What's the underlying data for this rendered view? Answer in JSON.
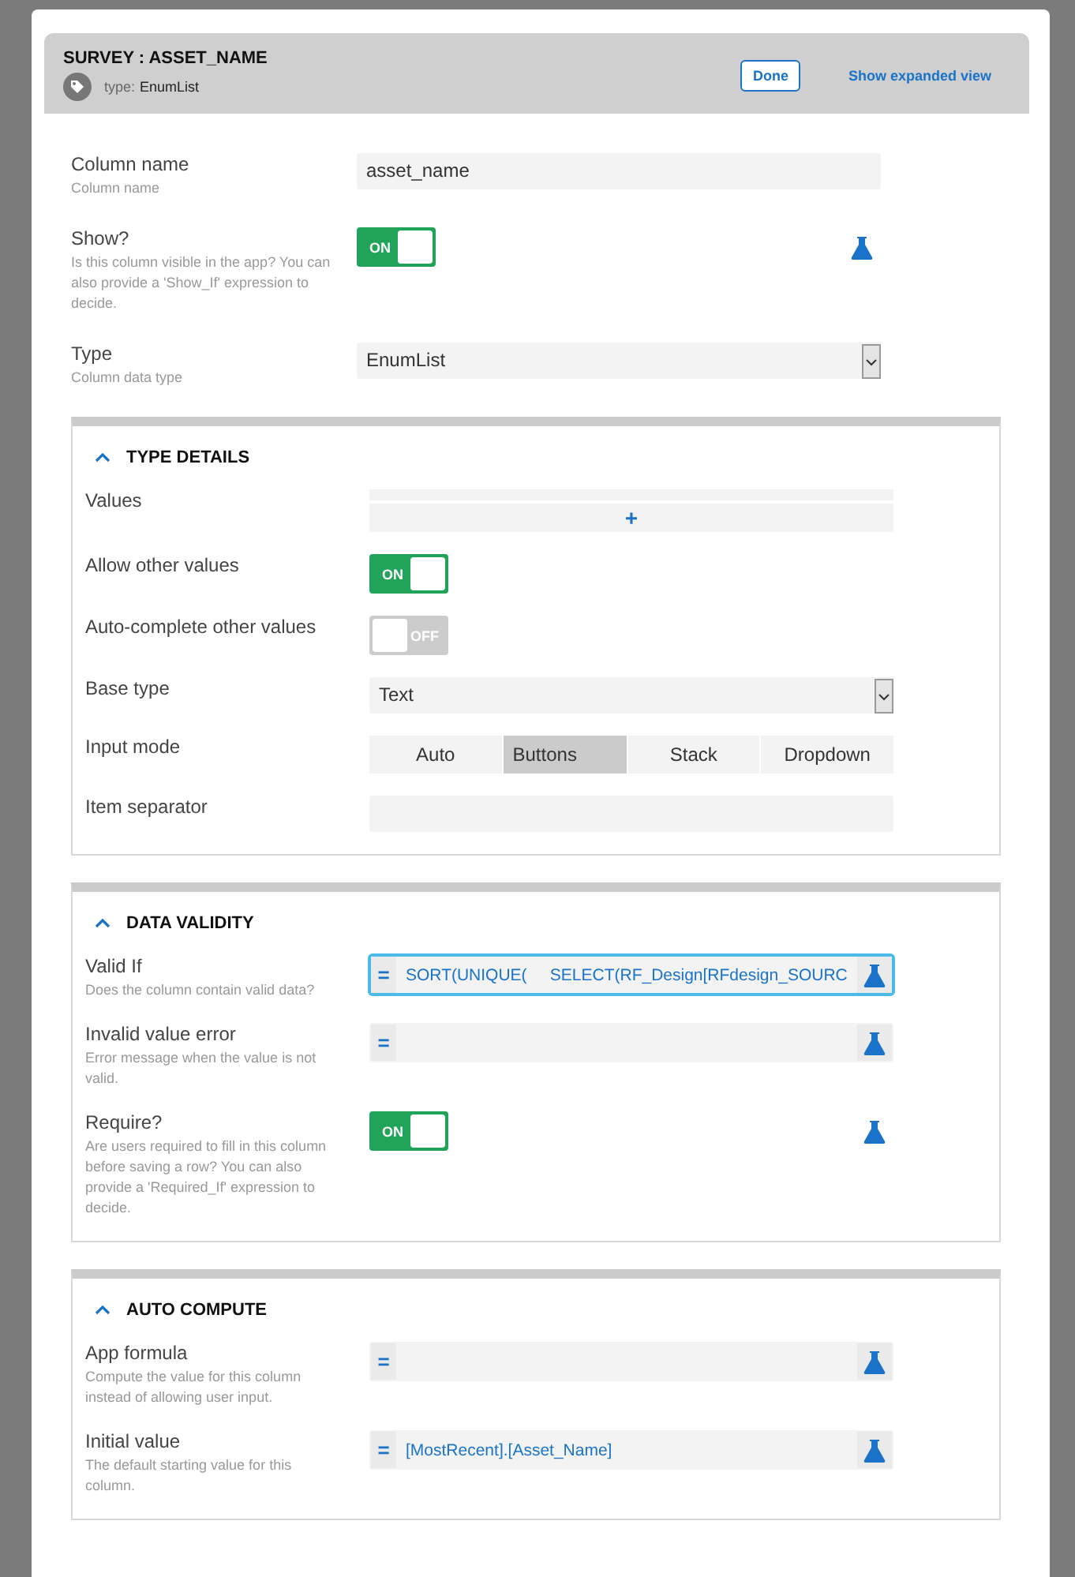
{
  "header": {
    "title": "SURVEY : ASSET_NAME",
    "type_label": "type:",
    "type_value": "EnumList",
    "done": "Done",
    "expanded_link": "Show expanded view"
  },
  "fields": [
    {
      "kind": "text",
      "label": "Column name",
      "hint": "Column name",
      "value": "asset_name"
    },
    {
      "kind": "toggle",
      "label": "Show?",
      "hint": "Is this column visible in the app? You can also provide a 'Show_If' expression to decide.",
      "on": true,
      "text": "ON",
      "test_icon": true
    },
    {
      "kind": "select",
      "label": "Type",
      "hint": "Column data type",
      "value": "EnumList"
    }
  ],
  "sections": [
    {
      "title": "TYPE DETAILS",
      "expanded": true,
      "fields": [
        {
          "kind": "list",
          "label": "Values",
          "add": "+"
        },
        {
          "kind": "toggle",
          "label": "Allow other values",
          "on": true,
          "text": "ON",
          "test_icon": false
        },
        {
          "kind": "toggle",
          "label": "Auto-complete other values",
          "on": false,
          "text": "OFF",
          "test_icon": false
        },
        {
          "kind": "select",
          "label": "Base type",
          "value": "Text"
        },
        {
          "kind": "segmented",
          "label": "Input mode",
          "options": [
            {
              "label": "Auto",
              "selected": false
            },
            {
              "label": "Buttons",
              "selected": true
            },
            {
              "label": "Stack",
              "selected": false
            },
            {
              "label": "Dropdown",
              "selected": false
            }
          ]
        },
        {
          "kind": "text",
          "label": "Item separator"
        }
      ]
    },
    {
      "title": "DATA VALIDITY",
      "expanded": true,
      "fields": [
        {
          "kind": "formula",
          "label": "Valid If",
          "hint": "Does the column contain valid data?",
          "prefix": "=",
          "value": "SORT(UNIQUE(     SELECT(RF_Design[RFdesign_SOURC",
          "focused": true
        },
        {
          "kind": "formula",
          "label": "Invalid value error",
          "hint": "Error message when the value is not valid.",
          "prefix": "=",
          "focused": false
        },
        {
          "kind": "toggle",
          "label": "Require?",
          "hint": "Are users required to fill in this column before saving a row? You can also provide a 'Required_If' expression to decide.",
          "on": true,
          "text": "ON",
          "test_icon": true
        }
      ]
    },
    {
      "title": "AUTO COMPUTE",
      "expanded": true,
      "fields": [
        {
          "kind": "formula",
          "label": "App formula",
          "hint": "Compute the value for this column instead of allowing user input.",
          "prefix": "=",
          "focused": false
        },
        {
          "kind": "formula",
          "label": "Initial value",
          "hint": "The default starting value for this column.",
          "prefix": "=",
          "value": "[MostRecent].[Asset_Name]",
          "focused": false
        }
      ]
    }
  ]
}
